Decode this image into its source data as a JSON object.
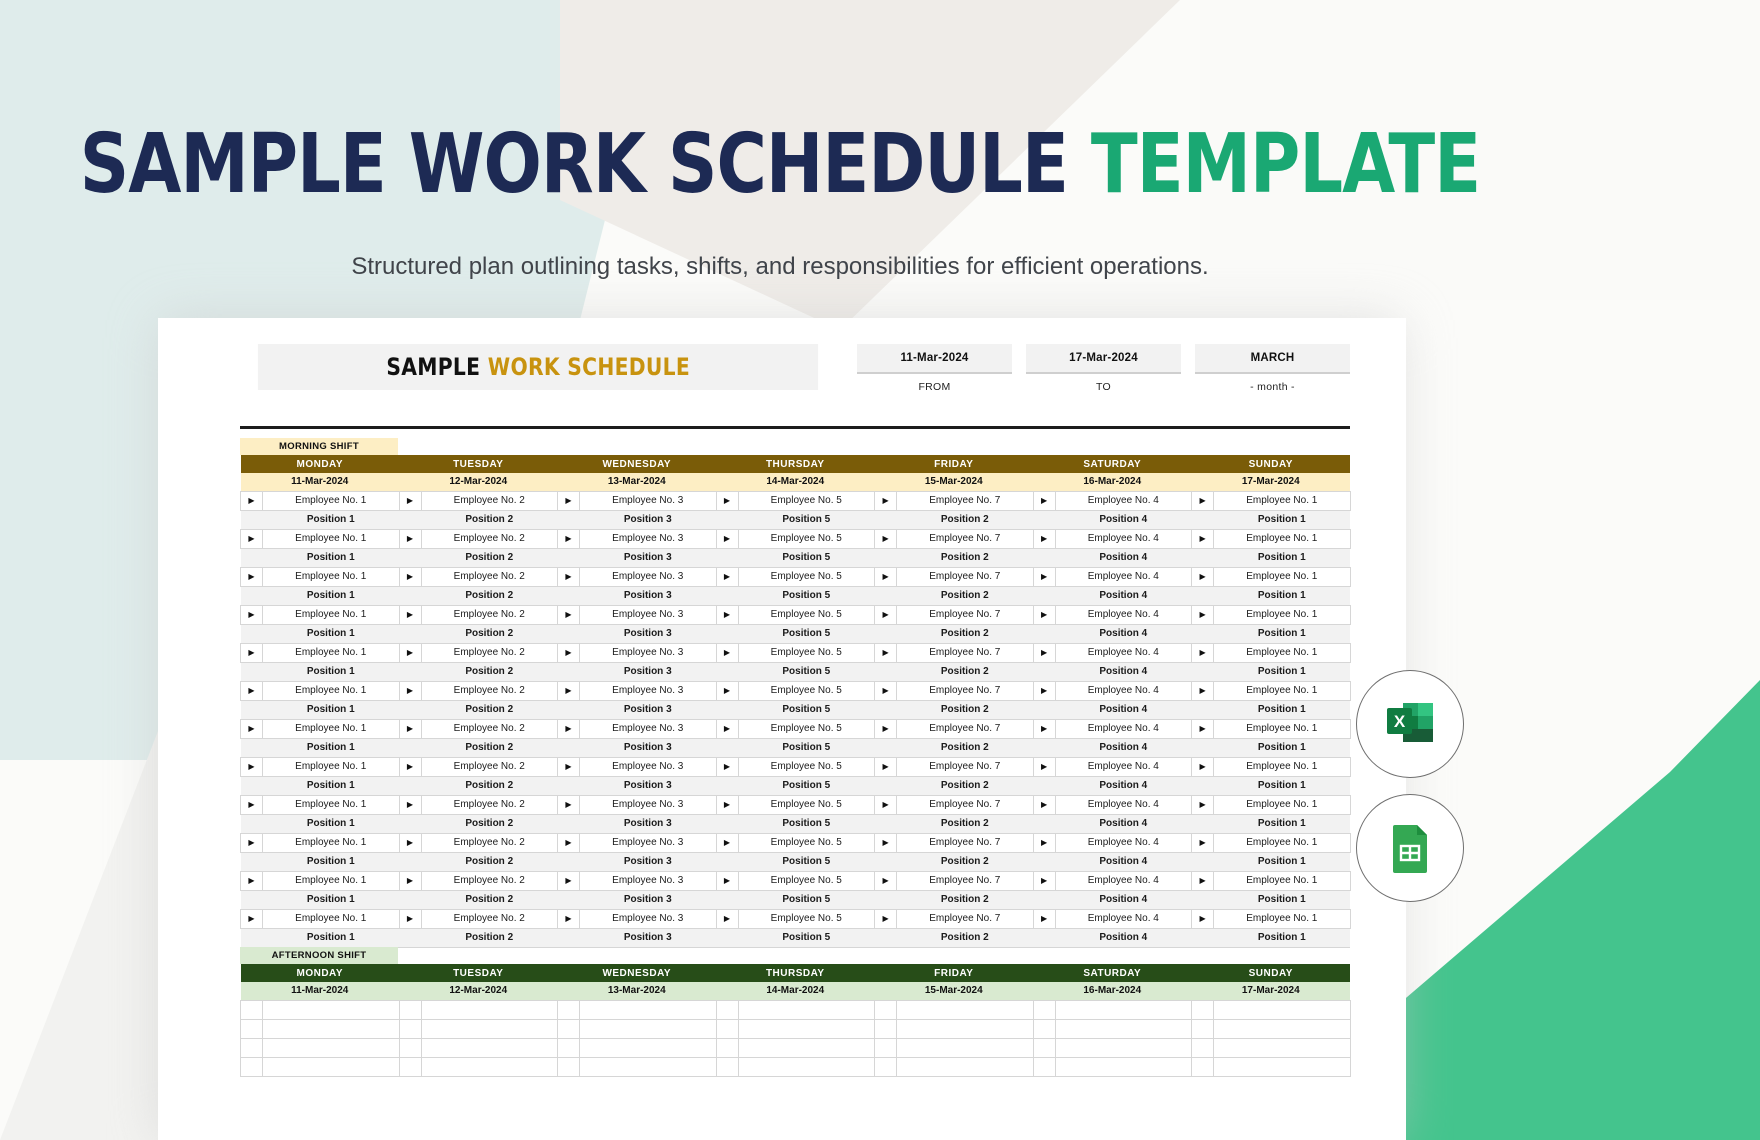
{
  "headline": {
    "dark_text": "SAMPLE WORK SCHEDULE",
    "green_text": "TEMPLATE",
    "dark_color": "#1d2a54",
    "green_color": "#1aa873"
  },
  "subtitle": "Structured plan outlining tasks, shifts, and responsibilities for efficient operations.",
  "sheet": {
    "title_part1": "SAMPLE",
    "title_part2": "WORK SCHEDULE",
    "title_accent_color": "#c8930f",
    "meta": [
      {
        "value": "11-Mar-2024",
        "label": "FROM"
      },
      {
        "value": "17-Mar-2024",
        "label": "TO"
      },
      {
        "value": "MARCH",
        "label": "- month -"
      }
    ]
  },
  "shifts": [
    {
      "tag": "MORNING SHIFT",
      "header_color": "#7a5c08",
      "accent_color": "#fdeec4",
      "days": [
        "MONDAY",
        "TUESDAY",
        "WEDNESDAY",
        "THURSDAY",
        "FRIDAY",
        "SATURDAY",
        "SUNDAY"
      ],
      "dates": [
        "11-Mar-2024",
        "12-Mar-2024",
        "13-Mar-2024",
        "14-Mar-2024",
        "15-Mar-2024",
        "16-Mar-2024",
        "17-Mar-2024"
      ],
      "employees": [
        "Employee No. 1",
        "Employee No. 2",
        "Employee No. 3",
        "Employee No. 5",
        "Employee No. 7",
        "Employee No. 4",
        "Employee No. 1"
      ],
      "positions": [
        "Position 1",
        "Position 2",
        "Position 3",
        "Position 5",
        "Position 2",
        "Position 4",
        "Position 1"
      ],
      "row_pairs": 12,
      "filled": true
    },
    {
      "tag": "AFTERNOON SHIFT",
      "header_color": "#274d18",
      "accent_color": "#d9ead0",
      "days": [
        "MONDAY",
        "TUESDAY",
        "WEDNESDAY",
        "THURSDAY",
        "FRIDAY",
        "SATURDAY",
        "SUNDAY"
      ],
      "dates": [
        "11-Mar-2024",
        "12-Mar-2024",
        "13-Mar-2024",
        "14-Mar-2024",
        "15-Mar-2024",
        "16-Mar-2024",
        "17-Mar-2024"
      ],
      "employees": [
        "",
        "",
        "",
        "",
        "",
        "",
        ""
      ],
      "positions": [
        "",
        "",
        "",
        "",
        "",
        "",
        ""
      ],
      "row_pairs": 2,
      "filled": false
    }
  ],
  "dropdown_glyph": "▶",
  "badges": [
    {
      "name": "excel-icon",
      "label": "Microsoft Excel"
    },
    {
      "name": "google-sheets-icon",
      "label": "Google Sheets"
    }
  ]
}
